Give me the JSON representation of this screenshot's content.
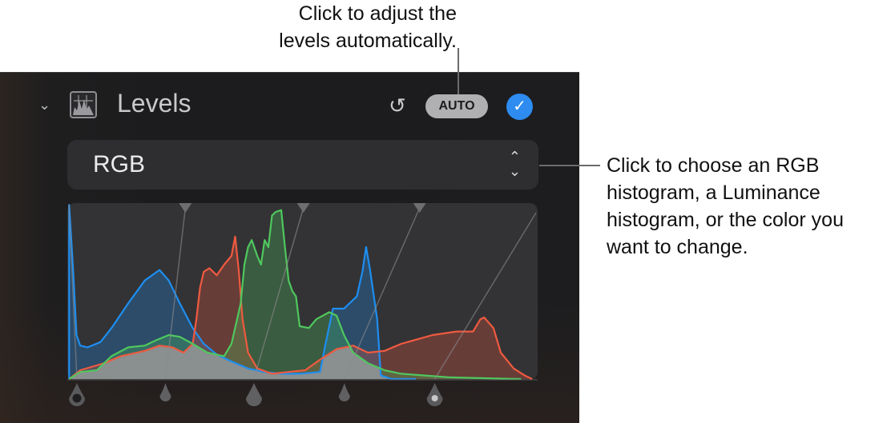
{
  "callouts": {
    "auto": [
      "Click to adjust the",
      "levels automatically."
    ],
    "channel": [
      "Click to choose an RGB",
      "histogram, a Luminance",
      "histogram, or the color you",
      "want to change."
    ]
  },
  "panel": {
    "title": "Levels",
    "auto_label": "AUTO",
    "undo_icon": "↺",
    "check_icon": "✓",
    "chevron_icon": "⌄",
    "channel_select": {
      "value": "RGB",
      "arrows": "⌃⌄"
    }
  },
  "colors": {
    "red": "#ef5a40",
    "green": "#4fc85e",
    "blue": "#1e8ef0",
    "accent": "#2e8cf0"
  },
  "histogram": {
    "x_range": [
      0,
      255
    ],
    "y_range": [
      0,
      100
    ],
    "blue": [
      [
        1,
        0
      ],
      [
        1,
        99
      ],
      [
        3,
        65
      ],
      [
        5,
        25
      ],
      [
        7,
        19
      ],
      [
        11,
        18
      ],
      [
        18,
        21
      ],
      [
        24,
        29
      ],
      [
        33,
        43
      ],
      [
        42,
        56
      ],
      [
        50,
        62
      ],
      [
        55,
        56
      ],
      [
        61,
        43
      ],
      [
        68,
        29
      ],
      [
        74,
        20
      ],
      [
        81,
        14
      ],
      [
        89,
        10
      ],
      [
        98,
        6
      ],
      [
        107,
        4
      ],
      [
        116,
        3
      ],
      [
        126,
        3
      ],
      [
        137,
        4
      ],
      [
        140,
        20
      ],
      [
        144,
        40
      ],
      [
        150,
        40
      ],
      [
        157,
        47
      ],
      [
        160,
        61
      ],
      [
        162,
        75
      ],
      [
        164,
        63
      ],
      [
        168,
        34
      ],
      [
        170,
        2
      ],
      [
        176,
        0
      ],
      [
        189,
        0
      ]
    ],
    "red": [
      [
        1,
        0
      ],
      [
        7,
        5
      ],
      [
        20,
        9
      ],
      [
        29,
        13
      ],
      [
        42,
        16
      ],
      [
        50,
        19
      ],
      [
        57,
        18
      ],
      [
        63,
        15
      ],
      [
        68,
        20
      ],
      [
        70,
        34
      ],
      [
        72,
        52
      ],
      [
        74,
        61
      ],
      [
        77,
        63
      ],
      [
        81,
        59
      ],
      [
        85,
        65
      ],
      [
        89,
        70
      ],
      [
        91,
        81
      ],
      [
        93,
        61
      ],
      [
        95,
        34
      ],
      [
        98,
        15
      ],
      [
        103,
        6
      ],
      [
        111,
        3
      ],
      [
        120,
        4
      ],
      [
        129,
        5
      ],
      [
        137,
        11
      ],
      [
        146,
        17
      ],
      [
        155,
        19
      ],
      [
        163,
        15
      ],
      [
        172,
        16
      ],
      [
        181,
        20
      ],
      [
        198,
        25
      ],
      [
        211,
        27
      ],
      [
        220,
        27
      ],
      [
        224,
        34
      ],
      [
        226,
        35
      ],
      [
        231,
        29
      ],
      [
        235,
        15
      ],
      [
        242,
        6
      ],
      [
        248,
        2
      ],
      [
        252,
        0
      ]
    ],
    "green": [
      [
        1,
        0
      ],
      [
        7,
        4
      ],
      [
        16,
        5
      ],
      [
        24,
        13
      ],
      [
        33,
        18
      ],
      [
        42,
        19
      ],
      [
        48,
        22
      ],
      [
        55,
        25
      ],
      [
        61,
        24
      ],
      [
        68,
        20
      ],
      [
        76,
        15
      ],
      [
        85,
        13
      ],
      [
        89,
        20
      ],
      [
        94,
        43
      ],
      [
        96,
        65
      ],
      [
        98,
        75
      ],
      [
        100,
        79
      ],
      [
        103,
        70
      ],
      [
        105,
        65
      ],
      [
        107,
        79
      ],
      [
        109,
        75
      ],
      [
        111,
        93
      ],
      [
        113,
        95
      ],
      [
        116,
        96
      ],
      [
        118,
        75
      ],
      [
        120,
        56
      ],
      [
        122,
        50
      ],
      [
        124,
        47
      ],
      [
        126,
        30
      ],
      [
        131,
        29
      ],
      [
        135,
        34
      ],
      [
        142,
        38
      ],
      [
        146,
        36
      ],
      [
        150,
        25
      ],
      [
        155,
        15
      ],
      [
        163,
        9
      ],
      [
        172,
        5
      ],
      [
        181,
        3
      ],
      [
        194,
        2
      ],
      [
        207,
        1
      ],
      [
        224,
        0.5
      ],
      [
        246,
        0
      ]
    ],
    "input_handles": [
      0,
      48,
      96,
      145,
      194
    ],
    "output_handles": [
      64,
      128,
      191
    ]
  }
}
